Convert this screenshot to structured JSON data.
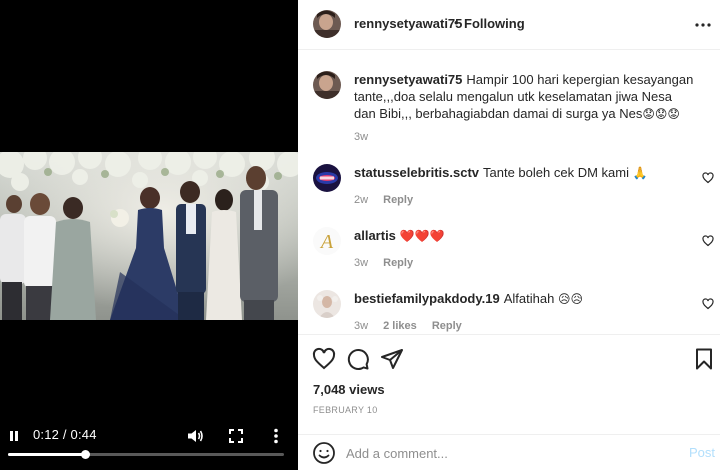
{
  "video": {
    "time_current": "0:12",
    "time_separator": " / ",
    "time_total": "0:44",
    "progress_fraction": 0.28
  },
  "header": {
    "username": "rennysetyawati75",
    "separator": "•",
    "follow_status": "Following"
  },
  "caption": {
    "username": "rennysetyawati75",
    "text": "Hampir 100 hari kepergian kesayangan tante,,,doa selalu mengalun utk keselamatan jiwa Nesa dan Bibi,,, berbahagiabdan damai di surga ya Nes",
    "emojis": "😟😟😟",
    "time": "3w"
  },
  "comments": [
    {
      "username": "statusselebritis.sctv",
      "text": "Tante boleh cek DM kami",
      "emojis": "🙏",
      "time": "2w",
      "reply": "Reply",
      "likes": ""
    },
    {
      "username": "allartis",
      "text": "",
      "emojis": "❤️❤️❤️",
      "time": "3w",
      "reply": "Reply",
      "likes": ""
    },
    {
      "username": "bestiefamilypakdody.19",
      "text": "Alfatihah",
      "emojis": "😥😥",
      "time": "3w",
      "reply": "Reply",
      "likes": "2 likes"
    }
  ],
  "stats": {
    "views": "7,048 views",
    "date": "February 10"
  },
  "add_comment": {
    "placeholder": "Add a comment...",
    "post_label": "Post"
  },
  "icons": {
    "play_state": "pause-icon",
    "volume": "volume-icon",
    "fullscreen": "fullscreen-icon",
    "menu": "more-vertical-icon",
    "like": "heart-icon",
    "comment": "comment-icon",
    "share": "send-icon",
    "save": "bookmark-icon",
    "emoji": "emoji-icon"
  },
  "colors": {
    "accent": "#0095f6",
    "post_disabled": "#b2dffc",
    "heart_red": "#ed4956",
    "muted_text": "#8e8e8e",
    "divider": "#efefef"
  }
}
